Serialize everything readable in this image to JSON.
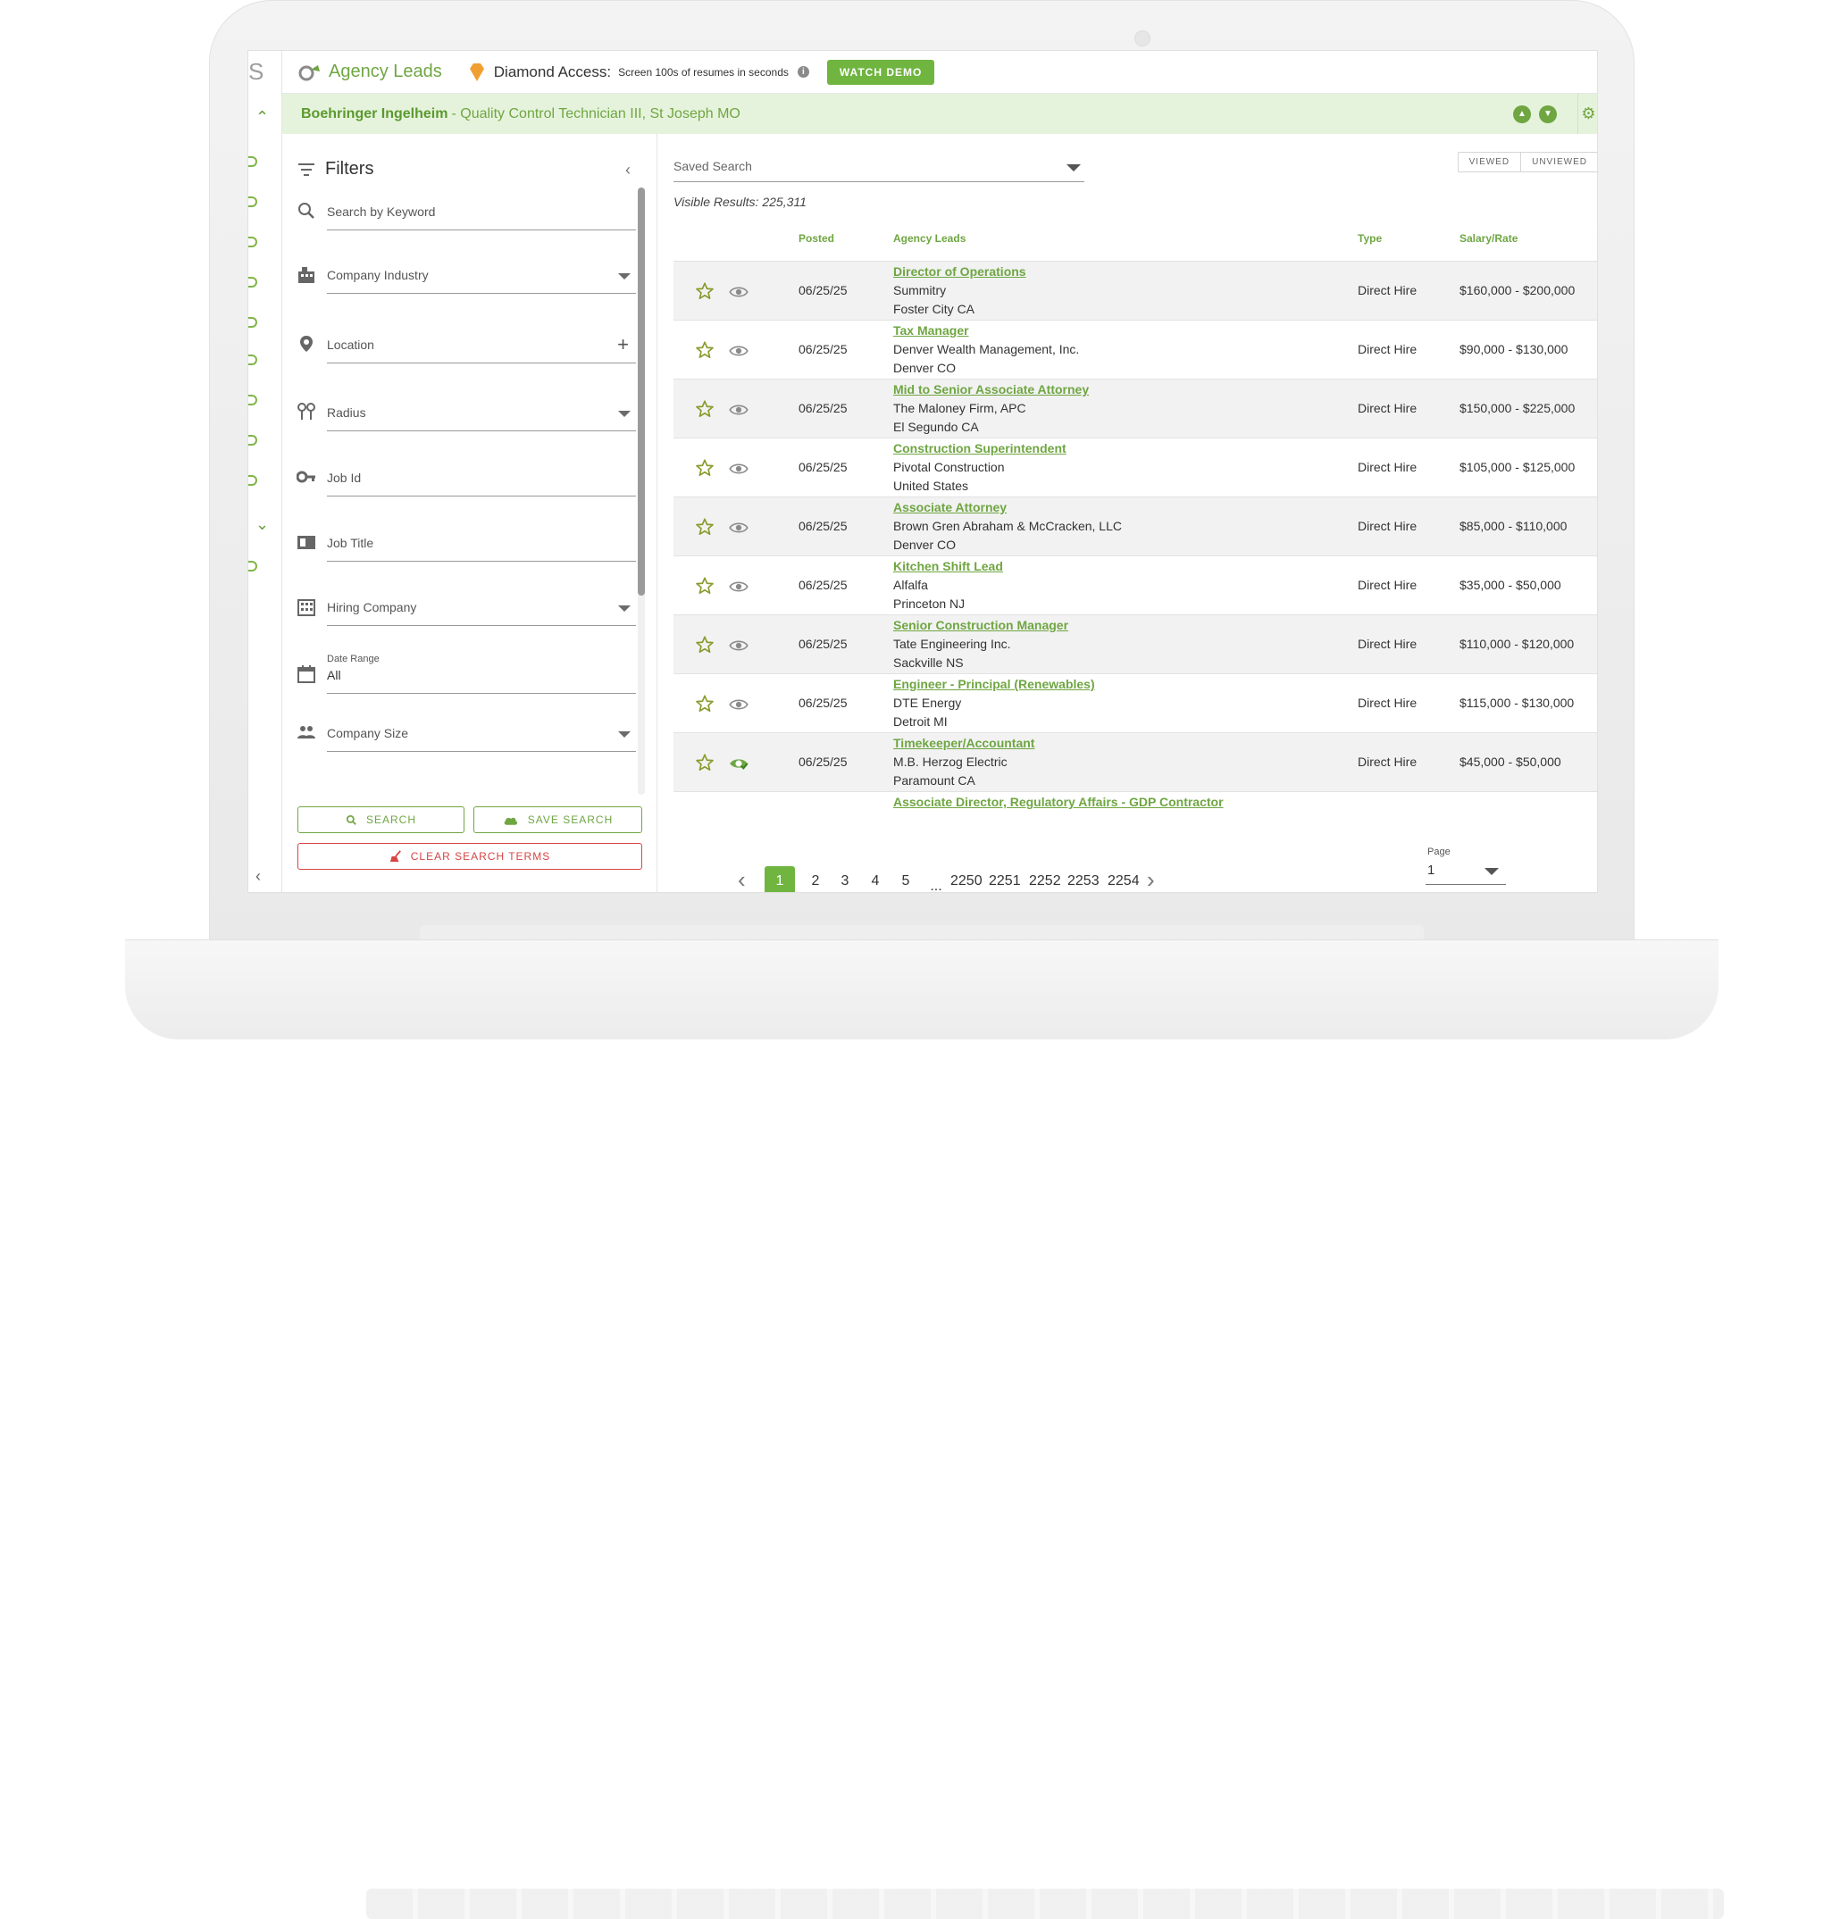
{
  "rail": {
    "logo_letter": "S"
  },
  "header": {
    "brand": "Agency Leads",
    "diamond_label": "Diamond Access:",
    "diamond_sub": "Screen 100s of resumes in seconds",
    "watch_demo": "WATCH DEMO"
  },
  "banner": {
    "company": "Boehringer Ingelheim",
    "rest": "- Quality Control Technician III, St Joseph MO"
  },
  "filters": {
    "title": "Filters",
    "keyword": "Search by Keyword",
    "industry": "Company Industry",
    "location": "Location",
    "radius": "Radius",
    "job_id": "Job Id",
    "job_title": "Job Title",
    "hiring_company": "Hiring Company",
    "date_range_label": "Date Range",
    "date_range_value": "All",
    "company_size": "Company Size",
    "search_btn": "SEARCH",
    "save_search_btn": "SAVE SEARCH",
    "clear_btn": "CLEAR SEARCH TERMS"
  },
  "results": {
    "saved_search": "Saved Search",
    "toggle_viewed": "VIEWED",
    "toggle_unviewed": "UNVIEWED",
    "visible_results": "Visible Results: 225,311",
    "columns": {
      "posted": "Posted",
      "agency_leads": "Agency Leads",
      "type": "Type",
      "salary": "Salary/Rate"
    },
    "rows": [
      {
        "date": "06/25/25",
        "title": "Director of Operations",
        "company": "Summitry",
        "location": "Foster City CA",
        "type": "Direct Hire",
        "salary": "$160,000 - $200,000",
        "viewed": false
      },
      {
        "date": "06/25/25",
        "title": "Tax Manager",
        "company": "Denver Wealth Management, Inc.",
        "location": "Denver CO",
        "type": "Direct Hire",
        "salary": "$90,000 - $130,000",
        "viewed": false
      },
      {
        "date": "06/25/25",
        "title": "Mid to Senior Associate Attorney",
        "company": "The Maloney Firm, APC",
        "location": "El Segundo CA",
        "type": "Direct Hire",
        "salary": "$150,000 - $225,000",
        "viewed": false
      },
      {
        "date": "06/25/25",
        "title": "Construction Superintendent",
        "company": "Pivotal Construction",
        "location": "United States",
        "type": "Direct Hire",
        "salary": "$105,000 - $125,000",
        "viewed": false
      },
      {
        "date": "06/25/25",
        "title": "Associate Attorney",
        "company": "Brown Gren Abraham & McCracken, LLC",
        "location": "Denver CO",
        "type": "Direct Hire",
        "salary": "$85,000 - $110,000",
        "viewed": false
      },
      {
        "date": "06/25/25",
        "title": "Kitchen Shift Lead",
        "company": "Alfalfa",
        "location": "Princeton NJ",
        "type": "Direct Hire",
        "salary": "$35,000 - $50,000",
        "viewed": false
      },
      {
        "date": "06/25/25",
        "title": "Senior Construction Manager",
        "company": "Tate Engineering Inc.",
        "location": "Sackville NS",
        "type": "Direct Hire",
        "salary": "$110,000 - $120,000",
        "viewed": false
      },
      {
        "date": "06/25/25",
        "title": "Engineer - Principal (Renewables)",
        "company": "DTE Energy",
        "location": "Detroit MI",
        "type": "Direct Hire",
        "salary": "$115,000 - $130,000",
        "viewed": false
      },
      {
        "date": "06/25/25",
        "title": "Timekeeper/Accountant",
        "company": "M.B. Herzog Electric",
        "location": "Paramount CA",
        "type": "Direct Hire",
        "salary": "$45,000 - $50,000",
        "viewed": true
      },
      {
        "date": "",
        "title": "Associate Director, Regulatory Affairs - GDP Contractor",
        "company": "",
        "location": "",
        "type": "",
        "salary": "",
        "viewed": false
      }
    ]
  },
  "pager": {
    "pages": [
      "1",
      "2",
      "3",
      "4",
      "5",
      "...",
      "2250",
      "2251",
      "2252",
      "2253",
      "2254"
    ],
    "active": "1",
    "select_label": "Page",
    "select_value": "1"
  },
  "colors": {
    "accent": "#6fa642",
    "button": "#6fb540",
    "banner_bg": "#e6f3dc",
    "diamond": "#f0a030",
    "clear": "#d64545"
  }
}
